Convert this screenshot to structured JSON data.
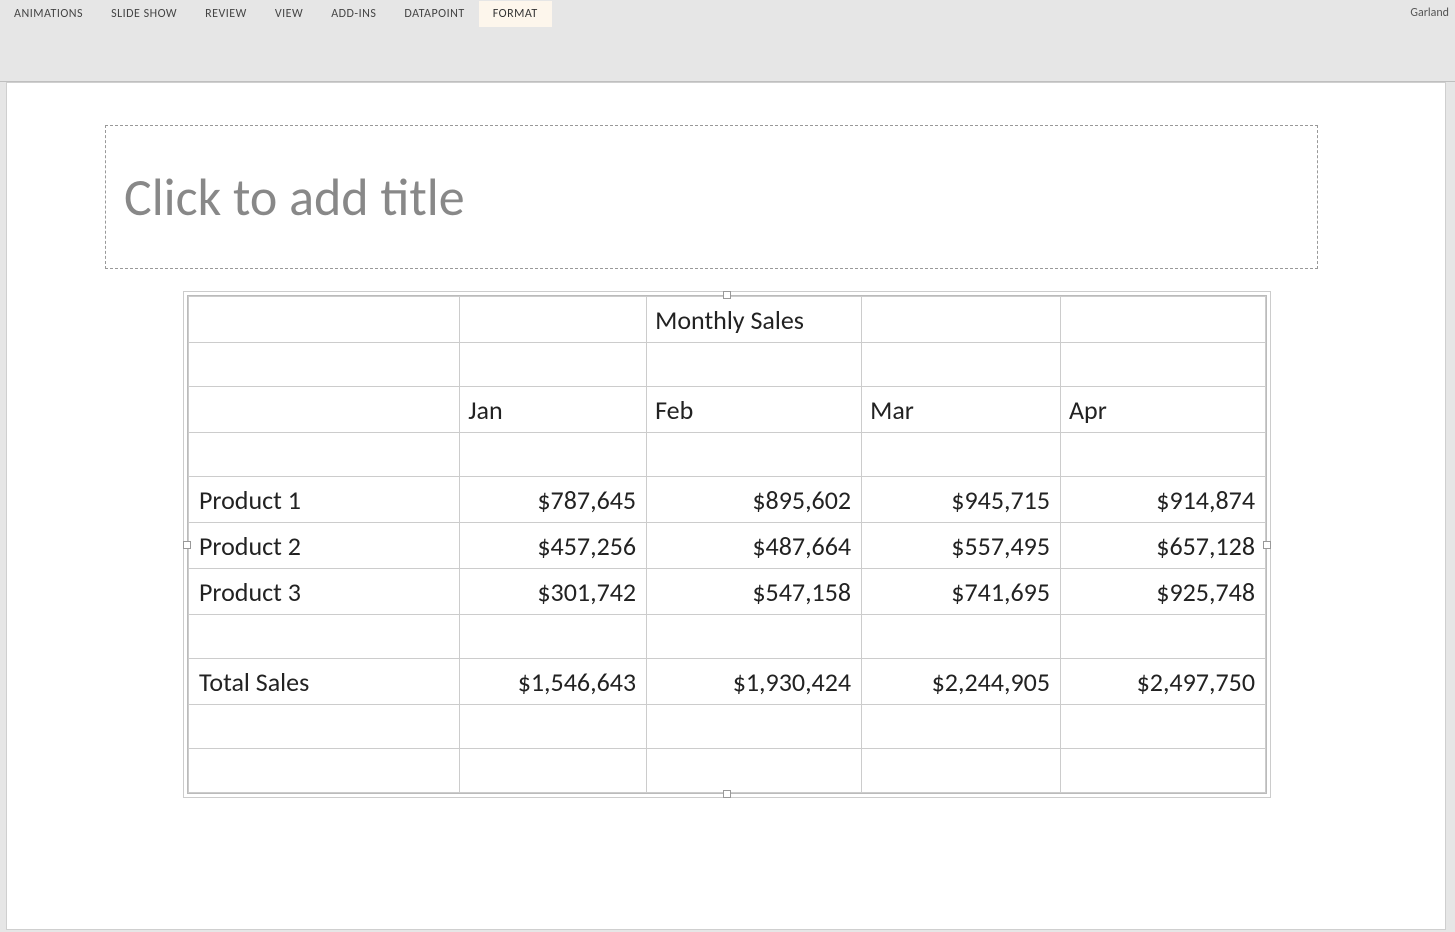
{
  "ribbon": {
    "tabs": [
      "ANIMATIONS",
      "SLIDE SHOW",
      "REVIEW",
      "VIEW",
      "ADD-INS",
      "DATAPOINT",
      "FORMAT"
    ],
    "activeTab": "FORMAT",
    "user": "Garland"
  },
  "slide": {
    "titlePlaceholder": "Click to add title"
  },
  "table": {
    "heading": "Monthly Sales",
    "months": [
      "Jan",
      "Feb",
      "Mar",
      "Apr"
    ],
    "rows": [
      {
        "label": "Product 1",
        "values": [
          "$787,645",
          "$895,602",
          "$945,715",
          "$914,874"
        ]
      },
      {
        "label": "Product 2",
        "values": [
          "$457,256",
          "$487,664",
          "$557,495",
          "$657,128"
        ]
      },
      {
        "label": "Product 3",
        "values": [
          "$301,742",
          "$547,158",
          "$741,695",
          "$925,748"
        ]
      }
    ],
    "totalLabel": "Total Sales",
    "totals": [
      "$1,546,643",
      "$1,930,424",
      "$2,244,905",
      "$2,497,750"
    ]
  }
}
